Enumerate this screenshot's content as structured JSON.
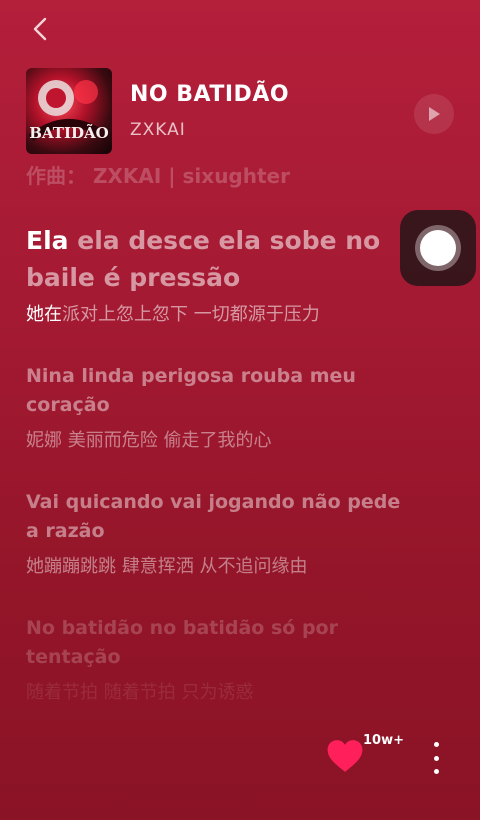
{
  "song": {
    "title": "NO BATIDÃO",
    "artist": "ZXKAI",
    "credits": "作曲： ZXKAI | sixughter",
    "cover_text": "BATIDÃO"
  },
  "lyrics": [
    {
      "orig_hl": "Ela",
      "orig_rest": " ela desce ela sobe no baile é pressão",
      "trans_hl": "她在",
      "trans_rest": "派对上忽上忽下 一切都源于压力"
    },
    {
      "orig": "Nina linda perigosa rouba meu coração",
      "trans": "妮娜 美丽而危险 偷走了我的心"
    },
    {
      "orig": "Vai quicando vai jogando não pede a razão",
      "trans": "她蹦蹦跳跳 肆意挥洒 从不追问缘由"
    },
    {
      "orig": "No batidão no batidão só por tentação",
      "trans": "随着节拍 随着节拍 只为诱惑"
    }
  ],
  "footer": {
    "like_count": "10w+"
  },
  "colors": {
    "background": "#a51a33",
    "heart": "#ff1f5a"
  },
  "icons": [
    "back-icon",
    "play-icon",
    "heart-icon",
    "more-icon"
  ]
}
